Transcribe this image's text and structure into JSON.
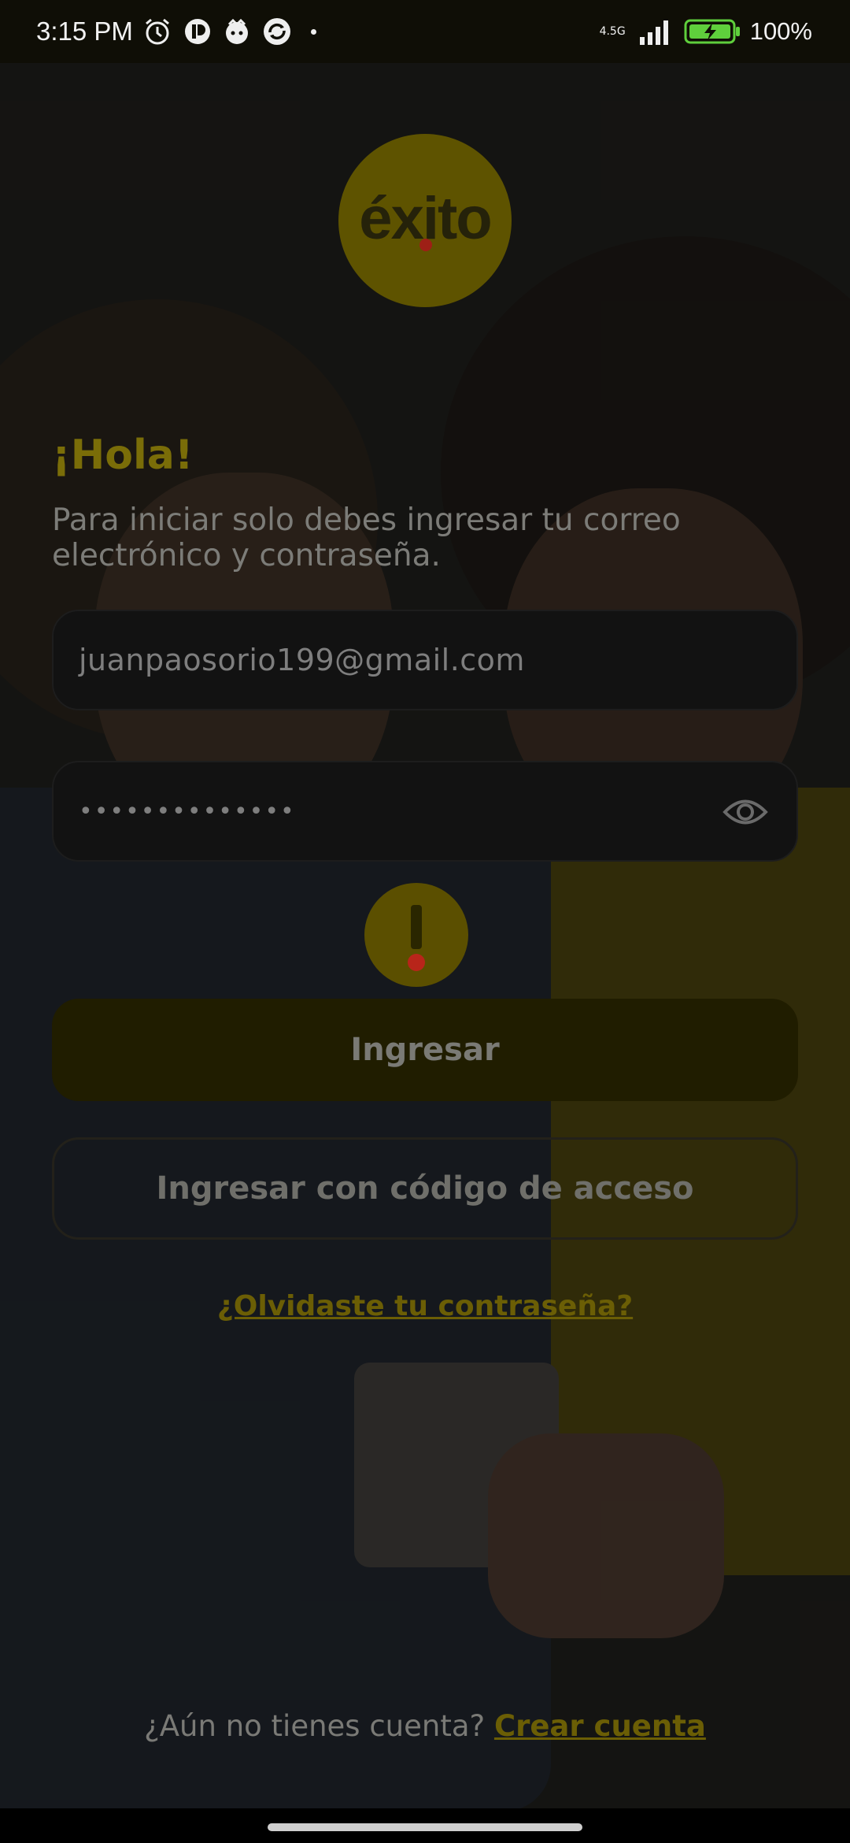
{
  "status_bar": {
    "time": "3:15 PM",
    "network": "4.5G",
    "battery": "100%"
  },
  "logo": {
    "text": "éxito"
  },
  "greeting": "¡Hola!",
  "subtitle": "Para iniciar solo debes ingresar tu correo electrónico y contraseña.",
  "email_field": {
    "value": "juanpaosorio199@gmail.com"
  },
  "password_field": {
    "value": "••••••••••••••"
  },
  "buttons": {
    "login": "Ingresar",
    "access_code": "Ingresar con código de acceso"
  },
  "forgot_password": "¿Olvidaste tu contraseña?",
  "signup": {
    "prompt": "¿Aún no tienes cuenta?",
    "link": "Crear cuenta"
  },
  "icons": [
    "alarm-icon",
    "app-notification-icon",
    "notification-icon",
    "sync-icon",
    "signal-icon",
    "battery-charging-icon",
    "eye-icon",
    "alert-icon"
  ],
  "colors": {
    "accent": "#f2d500",
    "alert_dot": "#e0301e"
  }
}
